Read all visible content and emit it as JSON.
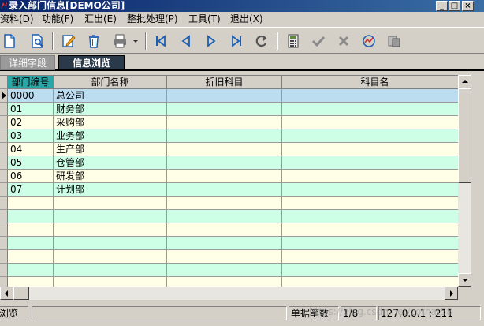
{
  "window": {
    "title": "录入部门信息[DEMO公司]",
    "controls": [
      "minimize",
      "maximize",
      "close"
    ]
  },
  "menu": [
    "资料(D)",
    "功能(F)",
    "汇出(E)",
    "整批处理(P)",
    "工具(T)",
    "退出(X)"
  ],
  "toolbar": {
    "buttons": [
      "new-icon",
      "preview-icon",
      "edit-icon",
      "delete-icon",
      "print-icon",
      "first-icon",
      "prev-icon",
      "next-icon",
      "last-icon",
      "refresh-icon",
      "calculator-icon",
      "check-icon",
      "cancel-icon",
      "chart-icon",
      "export-icon"
    ]
  },
  "tabs": [
    {
      "label": "详细字段",
      "active": false
    },
    {
      "label": "信息浏览",
      "active": true
    }
  ],
  "grid": {
    "columns": [
      "部门编号",
      "部门名称",
      "折旧科目",
      "科目名"
    ],
    "rows": [
      [
        "0000",
        "总公司",
        "",
        ""
      ],
      [
        "01",
        "财务部",
        "",
        ""
      ],
      [
        "02",
        "采购部",
        "",
        ""
      ],
      [
        "03",
        "业务部",
        "",
        ""
      ],
      [
        "04",
        "生产部",
        "",
        ""
      ],
      [
        "05",
        "仓管部",
        "",
        ""
      ],
      [
        "06",
        "研发部",
        "",
        ""
      ],
      [
        "07",
        "计划部",
        "",
        ""
      ]
    ],
    "empty_rows": 7,
    "colors": {
      "cream": "#fffee6",
      "mint": "#ccffe6",
      "selected": "#bcdcf0",
      "header_selected": "#2aa6a6"
    }
  },
  "status": {
    "mode": "浏览",
    "record_label": "单据笔数",
    "record_count": "1/8",
    "server": "127.0.0.1 : 211"
  },
  "watermark": "https://blog.csdn.net/cothat58"
}
